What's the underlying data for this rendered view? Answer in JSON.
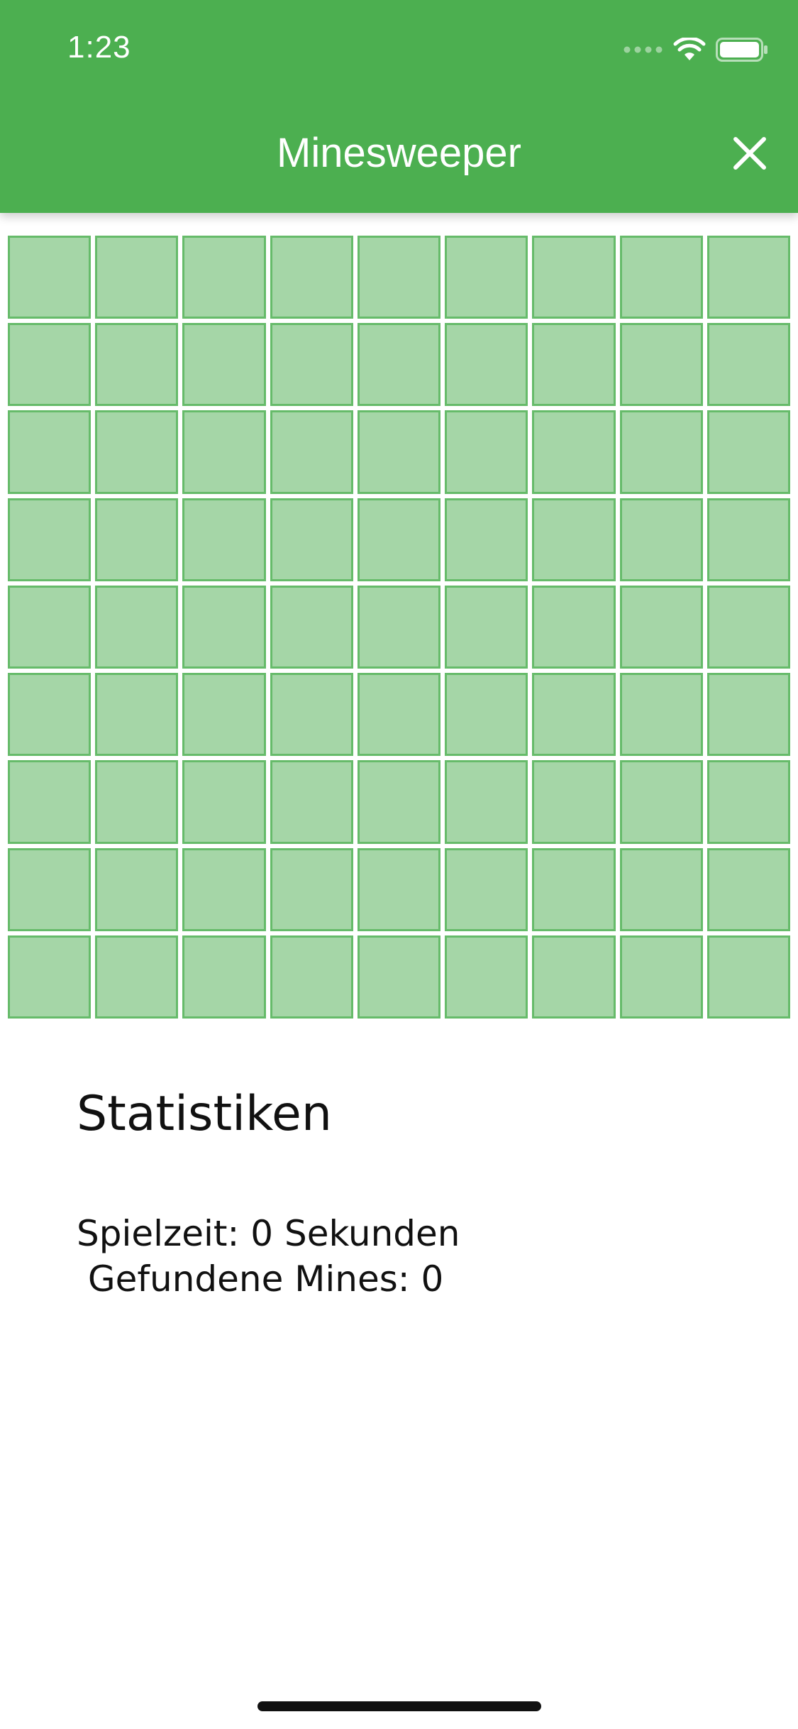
{
  "status_bar": {
    "time": "1:23",
    "icons": [
      "signal-dots-icon",
      "wifi-icon",
      "battery-icon"
    ]
  },
  "app_bar": {
    "title": "Minesweeper",
    "close_icon": "close-icon",
    "color": "#4caf50"
  },
  "board": {
    "rows": 9,
    "columns": 9,
    "cell_color": "#a5d6a7",
    "cell_border_color": "#66bb6a"
  },
  "stats": {
    "title": "Statistiken",
    "line1": "Spielzeit: 0 Sekunden",
    "line2": " Gefundene Mines: 0"
  }
}
